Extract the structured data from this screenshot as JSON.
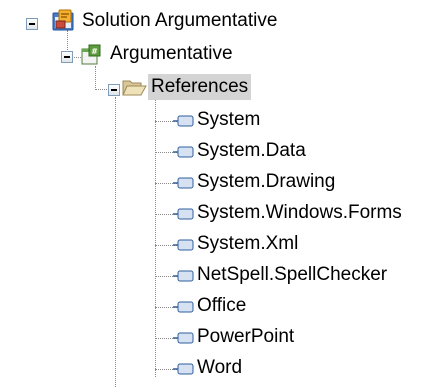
{
  "tree": {
    "solution": {
      "label": "Solution Argumentative",
      "icon": "solution-icon"
    },
    "project": {
      "label": "Argumentative",
      "icon": "csharp-project-icon"
    },
    "references_folder": {
      "label": "References",
      "icon": "open-folder-icon",
      "selected": true
    },
    "references": [
      {
        "label": "System",
        "icon": "reference-icon"
      },
      {
        "label": "System.Data",
        "icon": "reference-icon"
      },
      {
        "label": "System.Drawing",
        "icon": "reference-icon"
      },
      {
        "label": "System.Windows.Forms",
        "icon": "reference-icon"
      },
      {
        "label": "System.Xml",
        "icon": "reference-icon"
      },
      {
        "label": "NetSpell.SpellChecker",
        "icon": "reference-icon"
      },
      {
        "label": "Office",
        "icon": "reference-icon"
      },
      {
        "label": "PowerPoint",
        "icon": "reference-icon"
      },
      {
        "label": "Word",
        "icon": "reference-icon"
      }
    ]
  },
  "colors": {
    "selection": "#d4d4d4",
    "tree_lines": "#8a8a8a",
    "expander_border": "#7f9db9"
  }
}
